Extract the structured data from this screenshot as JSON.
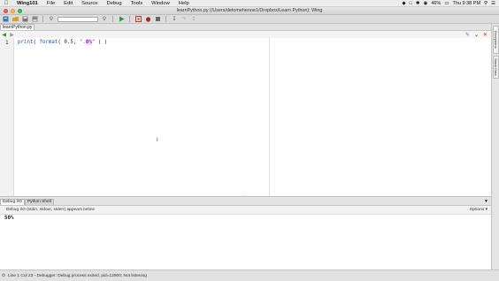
{
  "menubar": {
    "app_name": "Wing101",
    "items": [
      "File",
      "Edit",
      "Source",
      "Debug",
      "Tools",
      "Window",
      "Help"
    ],
    "battery": "46%",
    "clock": "Thu 9:38 PM"
  },
  "window": {
    "title": "learnPython.py (/Users/detomehenoe1/Dropbox/Learn Python): Wing"
  },
  "editor": {
    "tab_label": "learnPython.py",
    "line_number": "1",
    "code": {
      "fn": "print",
      "p1": "( ",
      "fn2": "format",
      "p2": "( ",
      "num": "0.5",
      "comma": ", ",
      "str_open": "\".",
      "str_fmt": "0%",
      "str_close": "\"",
      "tail": " ) )"
    }
  },
  "bottom_panel": {
    "tabs": [
      "Debug I/O",
      "Python Shell"
    ],
    "header_text": "Debug I/O (stdin, stdout, stderr) appears below",
    "options_label": "Options",
    "output": "50%"
  },
  "right_strip": {
    "tabs": [
      "Exceptions",
      "Stack Data"
    ]
  },
  "statusbar": {
    "text": "Line 1 Col 23 - Debugger: Debug process exited, pid=12900; Not listening"
  },
  "colors": {
    "run_green": "#2a9a2a",
    "stop_red": "#c0392b",
    "string_purple": "#8b2fb8",
    "number_blue": "#2050b0"
  }
}
